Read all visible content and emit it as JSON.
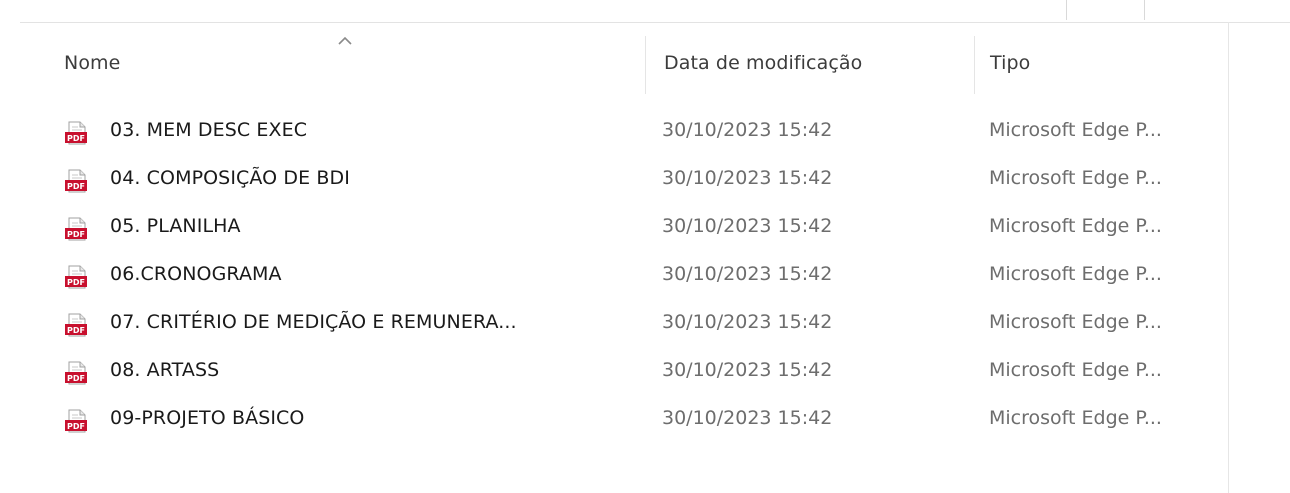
{
  "columns": {
    "name": "Nome",
    "date": "Data de modificação",
    "type": "Tipo",
    "sorted_by": "Nome",
    "sort_direction": "ascending"
  },
  "files": [
    {
      "name": "03. MEM DESC EXEC",
      "date": "30/10/2023 15:42",
      "type": "Microsoft Edge P...",
      "icon": "pdf-file-icon"
    },
    {
      "name": "04. COMPOSIÇÃO DE BDI",
      "date": "30/10/2023 15:42",
      "type": "Microsoft Edge P...",
      "icon": "pdf-file-icon"
    },
    {
      "name": "05. PLANILHA",
      "date": "30/10/2023 15:42",
      "type": "Microsoft Edge P...",
      "icon": "pdf-file-icon"
    },
    {
      "name": "06.CRONOGRAMA",
      "date": "30/10/2023 15:42",
      "type": "Microsoft Edge P...",
      "icon": "pdf-file-icon"
    },
    {
      "name": "07. CRITÉRIO DE MEDIÇÃO E REMUNERA...",
      "date": "30/10/2023 15:42",
      "type": "Microsoft Edge P...",
      "icon": "pdf-file-icon"
    },
    {
      "name": "08. ARTASS",
      "date": "30/10/2023 15:42",
      "type": "Microsoft Edge P...",
      "icon": "pdf-file-icon"
    },
    {
      "name": "09-PROJETO BÁSICO",
      "date": "30/10/2023 15:42",
      "type": "Microsoft Edge P...",
      "icon": "pdf-file-icon"
    }
  ],
  "colors": {
    "pdf_badge": "#c8102e",
    "header_text": "#3c3c3c",
    "secondary_text": "#6d6d6d"
  }
}
